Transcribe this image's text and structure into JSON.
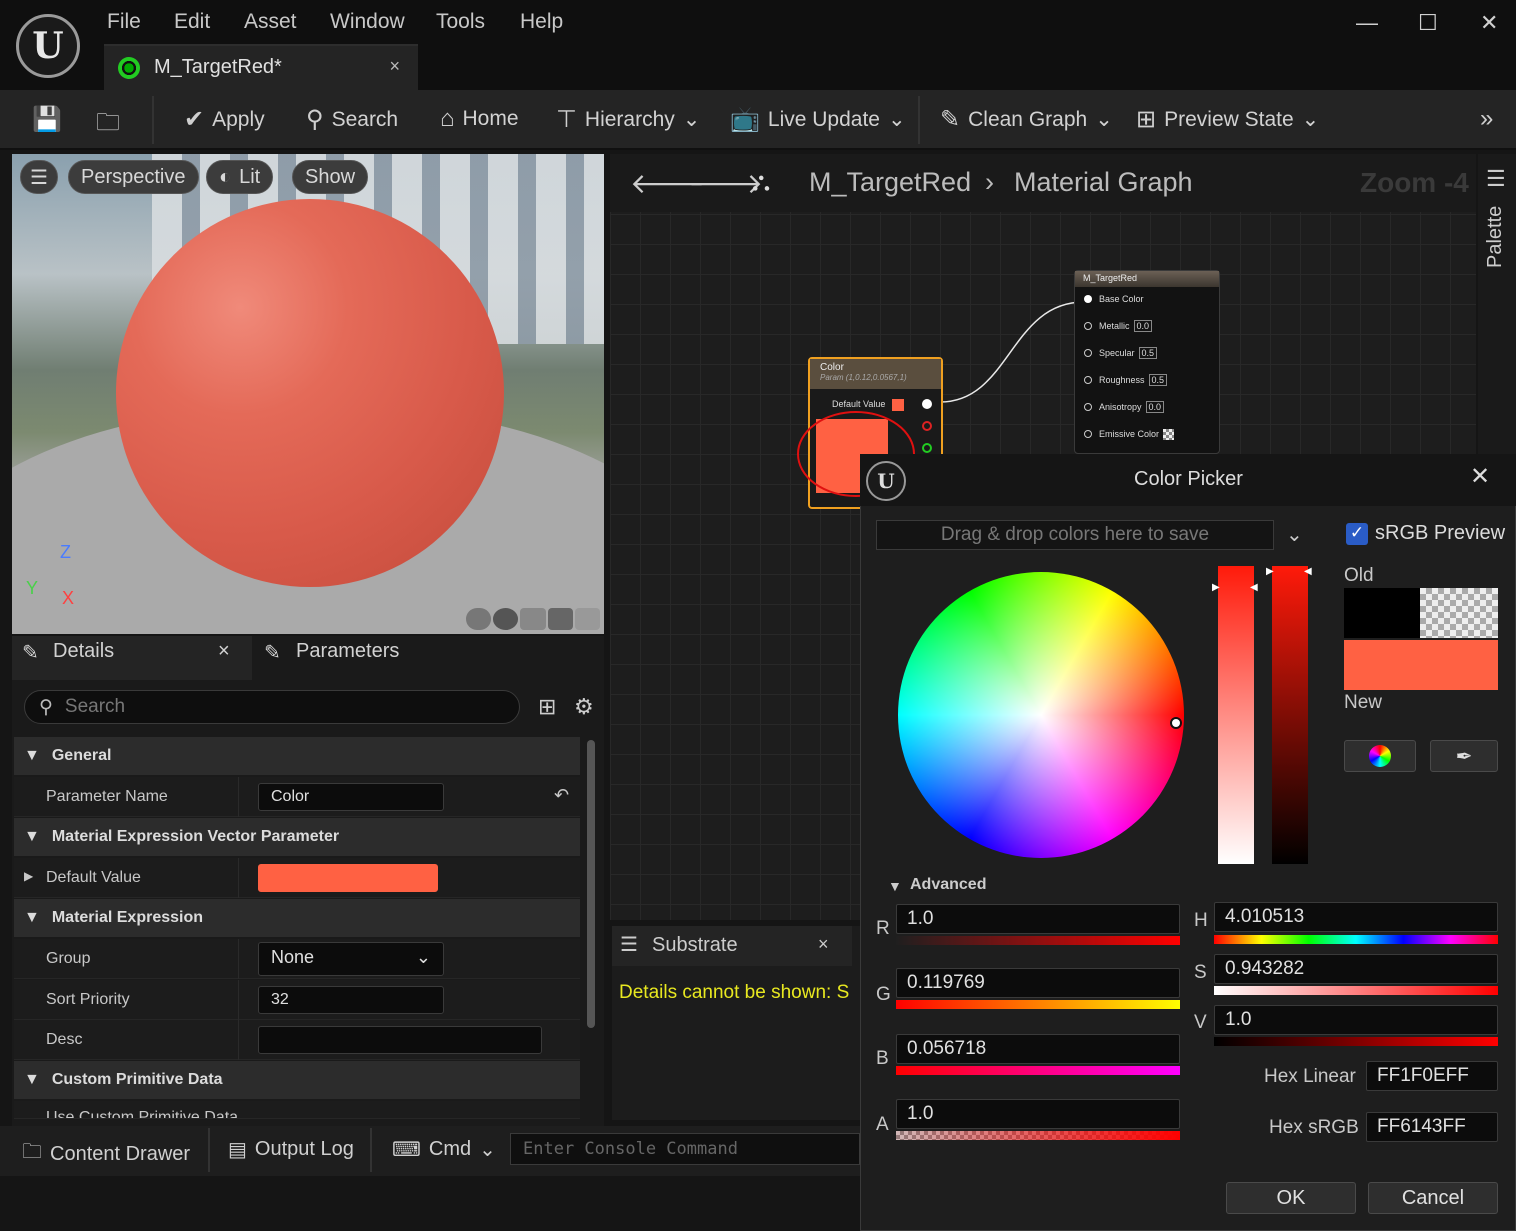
{
  "menu": [
    "File",
    "Edit",
    "Asset",
    "Window",
    "Tools",
    "Help"
  ],
  "doc_tab": {
    "title": "M_TargetRed*",
    "close": "×"
  },
  "window_buttons": {
    "min": "—",
    "max": "☐",
    "close": "✕"
  },
  "toolbar": {
    "apply": "Apply",
    "search": "Search",
    "home": "Home",
    "hierarchy": "Hierarchy",
    "live_update": "Live Update",
    "clean_graph": "Clean Graph",
    "preview_state": "Preview State"
  },
  "viewport": {
    "perspective": "Perspective",
    "lit": "Lit",
    "show": "Show",
    "axis_z": "Z",
    "axis_y": "Y",
    "axis_x": "X"
  },
  "details": {
    "tab_details": "Details",
    "tab_parameters": "Parameters",
    "search_placeholder": "Search",
    "cat_general": "General",
    "param_name_label": "Parameter Name",
    "param_name_value": "Color",
    "cat_vector": "Material Expression Vector Parameter",
    "default_value_label": "Default Value",
    "default_value_color": "#ff6143",
    "cat_expression": "Material Expression",
    "group_label": "Group",
    "group_value": "None",
    "sort_label": "Sort Priority",
    "sort_value": "32",
    "desc_label": "Desc",
    "desc_value": "",
    "cat_custom": "Custom Primitive Data",
    "custom_row": "Use Custom Primitive Data"
  },
  "graph": {
    "breadcrumb_asset": "M_TargetRed",
    "breadcrumb_graph": "Material Graph",
    "zoom": "Zoom -4",
    "palette": "Palette",
    "result_node": {
      "title": "M_TargetRed",
      "pins": [
        {
          "label": "Base Color",
          "value": ""
        },
        {
          "label": "Metallic",
          "value": "0.0"
        },
        {
          "label": "Specular",
          "value": "0.5"
        },
        {
          "label": "Roughness",
          "value": "0.5"
        },
        {
          "label": "Anisotropy",
          "value": "0.0"
        },
        {
          "label": "Emissive Color",
          "value": ""
        }
      ]
    },
    "color_node": {
      "title": "Color",
      "subtitle": "Param (1,0.12,0.0567,1)",
      "default_label": "Default Value"
    }
  },
  "substrate": {
    "title": "Substrate",
    "message": "Details cannot be shown: S"
  },
  "bottom": {
    "content_drawer": "Content Drawer",
    "output_log": "Output Log",
    "cmd": "Cmd",
    "console_placeholder": "Enter Console Command"
  },
  "color_picker": {
    "title": "Color Picker",
    "drag_drop": "Drag & drop colors here to save",
    "srgb_preview": "sRGB Preview",
    "old_label": "Old",
    "new_label": "New",
    "advanced": "Advanced",
    "r_label": "R",
    "r_value": "1.0",
    "g_label": "G",
    "g_value": "0.119769",
    "b_label": "B",
    "b_value": "0.056718",
    "a_label": "A",
    "a_value": "1.0",
    "h_label": "H",
    "h_value": "4.010513",
    "s_label": "S",
    "s_value": "0.943282",
    "v_label": "V",
    "v_value": "1.0",
    "hex_linear_label": "Hex Linear",
    "hex_linear_value": "FF1F0EFF",
    "hex_srgb_label": "Hex sRGB",
    "hex_srgb_value": "FF6143FF",
    "ok": "OK",
    "cancel": "Cancel",
    "new_color": "#ff6143",
    "old_color": "#000000"
  }
}
